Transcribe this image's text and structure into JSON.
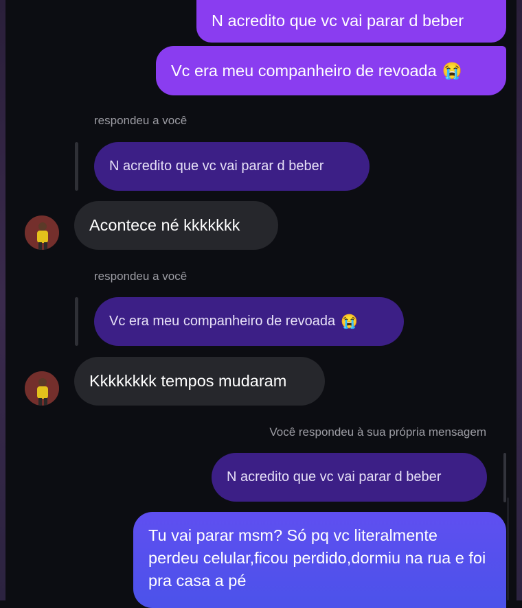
{
  "messages": {
    "sent_1": "N acredito que vc vai parar d beber",
    "sent_2": "Vc era meu companheiro de revoada",
    "reply_label_1": "respondeu a você",
    "reply_ctx_1": "N acredito que vc vai parar d beber",
    "recv_1": "Acontece né  kkkkkkk",
    "reply_label_2": "respondeu a você",
    "reply_ctx_2": "Vc era meu companheiro de revoada",
    "recv_2": "Kkkkkkkk tempos mudaram",
    "self_reply_label": "Você respondeu à sua própria mensagem",
    "self_reply_ctx": "N acredito que vc vai parar d beber",
    "final_message": "Tu vai parar msm? Só pq vc literalmente perdeu celular,ficou perdido,dormiu na rua e foi pra casa a pé"
  },
  "emoji": {
    "crying": "😭"
  },
  "colors": {
    "background": "#0c0d12",
    "sent_bubble": "#8a3df0",
    "reply_context_bubble": "#3c1f86",
    "received_bubble": "#26272c",
    "final_bubble": "#5b50ee",
    "meta_text": "#9d9da4"
  }
}
